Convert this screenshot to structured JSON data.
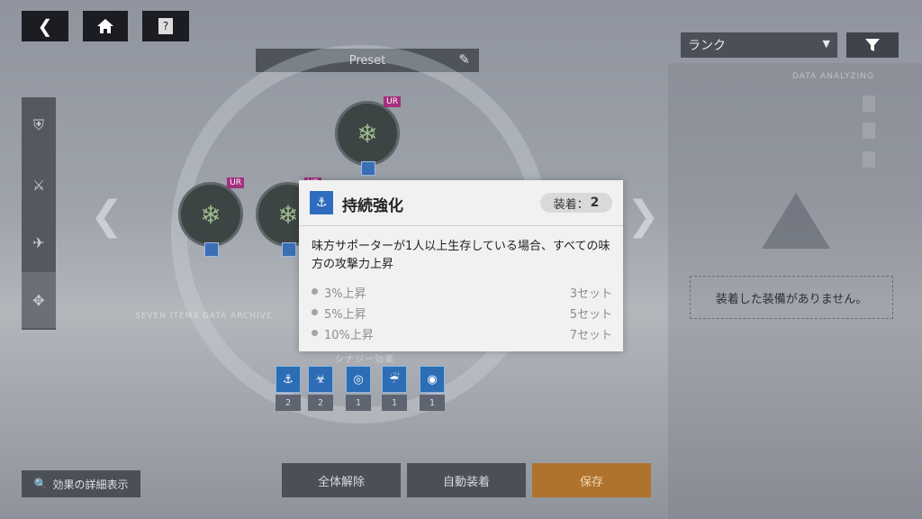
{
  "top_buttons": {
    "back_icon": "chevron-left",
    "home_icon": "home",
    "help_label": "?"
  },
  "preset": {
    "label": "Preset",
    "edit_icon": "pencil"
  },
  "rank_dropdown": {
    "label": "ランク",
    "caret": "▼"
  },
  "filter_icon": "filter",
  "sidebar": {
    "items": [
      "shield",
      "sword",
      "plane",
      "move"
    ],
    "active_index": 3
  },
  "slots": [
    {
      "grade": "UR",
      "set_icon": "bullet"
    },
    {
      "grade": "UR",
      "set_icon": "anchor"
    },
    {
      "grade": "UR",
      "set_icon": "anchor"
    }
  ],
  "background_text": {
    "seven_items": "SEVEN ITEMS DATA ARCHIVE",
    "data_analyzing": "DATA ANALYZING",
    "synergy_label": "シナジー効果"
  },
  "set_effects": [
    {
      "icon": "anchor-icon",
      "count": "2"
    },
    {
      "icon": "biohazard-icon",
      "count": "2"
    },
    {
      "icon": "shield-swirl-icon",
      "count": "1"
    },
    {
      "icon": "rain-icon",
      "count": "1"
    },
    {
      "icon": "target-icon",
      "count": "1"
    }
  ],
  "right_panel": {
    "empty_message": "装着した装備がありません。"
  },
  "bottom_buttons": {
    "detail": "効果の詳細表示",
    "release_all": "全体解除",
    "auto_equip": "自動装着",
    "save": "保存"
  },
  "popup": {
    "title": "持続強化",
    "equip_label": "装着：",
    "equip_count": "2",
    "description": "味方サポーターが1人以上生存している場合、すべての味方の攻撃力上昇",
    "tiers": [
      {
        "effect": "3%上昇",
        "requirement": "3セット"
      },
      {
        "effect": "5%上昇",
        "requirement": "5セット"
      },
      {
        "effect": "10%上昇",
        "requirement": "7セット"
      }
    ]
  },
  "colors": {
    "accent_blue": "#2f6cc0",
    "ur_tag": "#a4307e",
    "save_orange": "#b0732d"
  }
}
